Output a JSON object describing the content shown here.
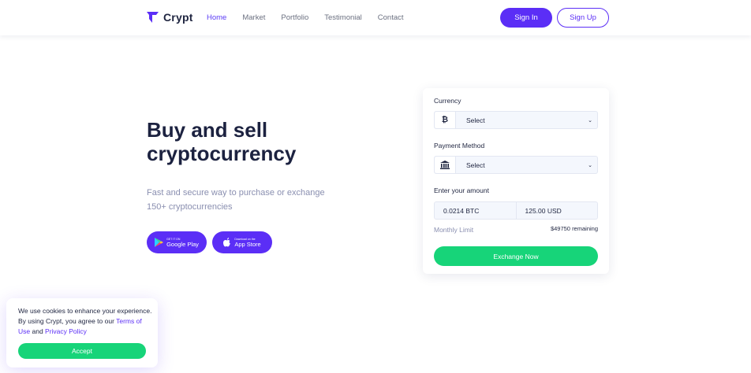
{
  "colors": {
    "brand": "#5b2ef6",
    "accent_green": "#17d479",
    "heading": "#1c2240",
    "muted": "#8a8fb0"
  },
  "brand": {
    "name": "Crypt",
    "icon": "crypt-logo-icon"
  },
  "nav": {
    "items": [
      {
        "label": "Home",
        "active": true
      },
      {
        "label": "Market"
      },
      {
        "label": "Portfolio"
      },
      {
        "label": "Testimonial"
      },
      {
        "label": "Contact"
      }
    ]
  },
  "auth": {
    "signin_label": "Sign In",
    "signup_label": "Sign Up"
  },
  "hero": {
    "title": "Buy and sell cryptocurrency",
    "subtitle": "Fast and secure way to purchase or exchange 150+ cryptocurrencies",
    "google_play": {
      "small": "GET IT ON",
      "big": "Google Play",
      "icon": "google-play-icon"
    },
    "app_store": {
      "small": "Download on the",
      "big": "App Store",
      "icon": "apple-icon"
    }
  },
  "exchange": {
    "currency_label": "Currency",
    "currency_icon": "bitcoin-icon",
    "currency_value": "Select",
    "payment_label": "Payment Method",
    "payment_icon": "bank-icon",
    "payment_value": "Select",
    "amount_label": "Enter your amount",
    "amount_btc": "0.0214 BTC",
    "amount_usd": "125.00 USD",
    "limit_label": "Monthly Limit",
    "limit_remaining": "$49750 remaining",
    "submit_label": "Exchange Now"
  },
  "cookie": {
    "text_before": "We use cookies to enhance your experience. By using Crypt, you agree to our ",
    "terms_link": "Terms of Use",
    "and": " and ",
    "privacy_link": "Privacy Policy",
    "accept_label": "Accept"
  }
}
